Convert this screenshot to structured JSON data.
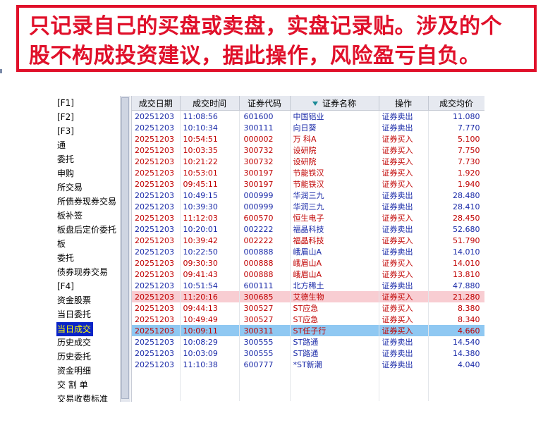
{
  "banner": {
    "line1": "只记录自己的买盘或卖盘，实盘记录贴。涉及的个",
    "line2": "股不构成投资建议，据此操作，风险盈亏自负。"
  },
  "nav": {
    "items": [
      "[F1]",
      "[F2]",
      "[F3]",
      "通",
      "委托",
      "申购",
      "所交易",
      "所债券现券交易",
      "板补签",
      "板盘后定价委托",
      "板",
      "委托",
      "债券现券交易",
      "[F4]",
      "资金股票",
      "当日委托",
      "当日成交",
      "历史成交",
      "历史委托",
      "资金明细",
      "交 割 单",
      "交易收费标准"
    ],
    "selected_index": 16
  },
  "grid": {
    "headers": [
      "成交日期",
      "成交时间",
      "证券代码",
      "证券名称",
      "操作",
      "成交均价"
    ],
    "rows": [
      {
        "date": "20251203",
        "time": "11:08:56",
        "code": "601600",
        "name": "中国铝业",
        "op": "证券卖出",
        "price": "11.080"
      },
      {
        "date": "20251203",
        "time": "10:10:34",
        "code": "300111",
        "name": "向日葵",
        "op": "证券卖出",
        "price": "7.770"
      },
      {
        "date": "20251203",
        "time": "10:54:51",
        "code": "000002",
        "name": "万 科A",
        "op": "证券买入",
        "price": "5.100"
      },
      {
        "date": "20251203",
        "time": "10:03:35",
        "code": "300732",
        "name": "设研院",
        "op": "证券买入",
        "price": "7.750"
      },
      {
        "date": "20251203",
        "time": "10:21:22",
        "code": "300732",
        "name": "设研院",
        "op": "证券买入",
        "price": "7.730"
      },
      {
        "date": "20251203",
        "time": "10:53:01",
        "code": "300197",
        "name": "节能铁汉",
        "op": "证券买入",
        "price": "1.920"
      },
      {
        "date": "20251203",
        "time": "09:45:11",
        "code": "300197",
        "name": "节能铁汉",
        "op": "证券买入",
        "price": "1.940"
      },
      {
        "date": "20251203",
        "time": "10:49:15",
        "code": "000999",
        "name": "华润三九",
        "op": "证券卖出",
        "price": "28.480"
      },
      {
        "date": "20251203",
        "time": "10:39:30",
        "code": "000999",
        "name": "华润三九",
        "op": "证券卖出",
        "price": "28.410"
      },
      {
        "date": "20251203",
        "time": "11:12:03",
        "code": "600570",
        "name": "恒生电子",
        "op": "证券买入",
        "price": "28.450"
      },
      {
        "date": "20251203",
        "time": "10:20:01",
        "code": "002222",
        "name": "福晶科技",
        "op": "证券卖出",
        "price": "52.680"
      },
      {
        "date": "20251203",
        "time": "10:39:42",
        "code": "002222",
        "name": "福晶科技",
        "op": "证券买入",
        "price": "51.790"
      },
      {
        "date": "20251203",
        "time": "10:22:50",
        "code": "000888",
        "name": "峨眉山A",
        "op": "证券卖出",
        "price": "14.010"
      },
      {
        "date": "20251203",
        "time": "09:30:30",
        "code": "000888",
        "name": "峨眉山A",
        "op": "证券买入",
        "price": "14.010"
      },
      {
        "date": "20251203",
        "time": "09:41:43",
        "code": "000888",
        "name": "峨眉山A",
        "op": "证券买入",
        "price": "13.810"
      },
      {
        "date": "20251203",
        "time": "10:51:54",
        "code": "600111",
        "name": "北方稀土",
        "op": "证券卖出",
        "price": "47.880"
      },
      {
        "date": "20251203",
        "time": "11:20:16",
        "code": "300685",
        "name": "艾德生物",
        "op": "证券买入",
        "price": "21.280"
      },
      {
        "date": "20251203",
        "time": "09:44:13",
        "code": "300527",
        "name": "ST应急",
        "op": "证券买入",
        "price": "8.380"
      },
      {
        "date": "20251203",
        "time": "10:49:49",
        "code": "300527",
        "name": "ST应急",
        "op": "证券买入",
        "price": "8.340"
      },
      {
        "date": "20251203",
        "time": "10:09:11",
        "code": "300311",
        "name": "ST任子行",
        "op": "证券买入",
        "price": "4.660"
      },
      {
        "date": "20251203",
        "time": "10:08:29",
        "code": "300555",
        "name": "ST路通",
        "op": "证券卖出",
        "price": "14.540"
      },
      {
        "date": "20251203",
        "time": "10:03:09",
        "code": "300555",
        "name": "ST路通",
        "op": "证券卖出",
        "price": "14.380"
      },
      {
        "date": "20251203",
        "time": "11:10:38",
        "code": "600777",
        "name": "*ST新潮",
        "op": "证券卖出",
        "price": "4.040"
      }
    ],
    "highlight_pink_index": 16,
    "highlight_blue_index": 19,
    "sell_color": "#1a2aa8",
    "buy_color": "#c00000"
  }
}
